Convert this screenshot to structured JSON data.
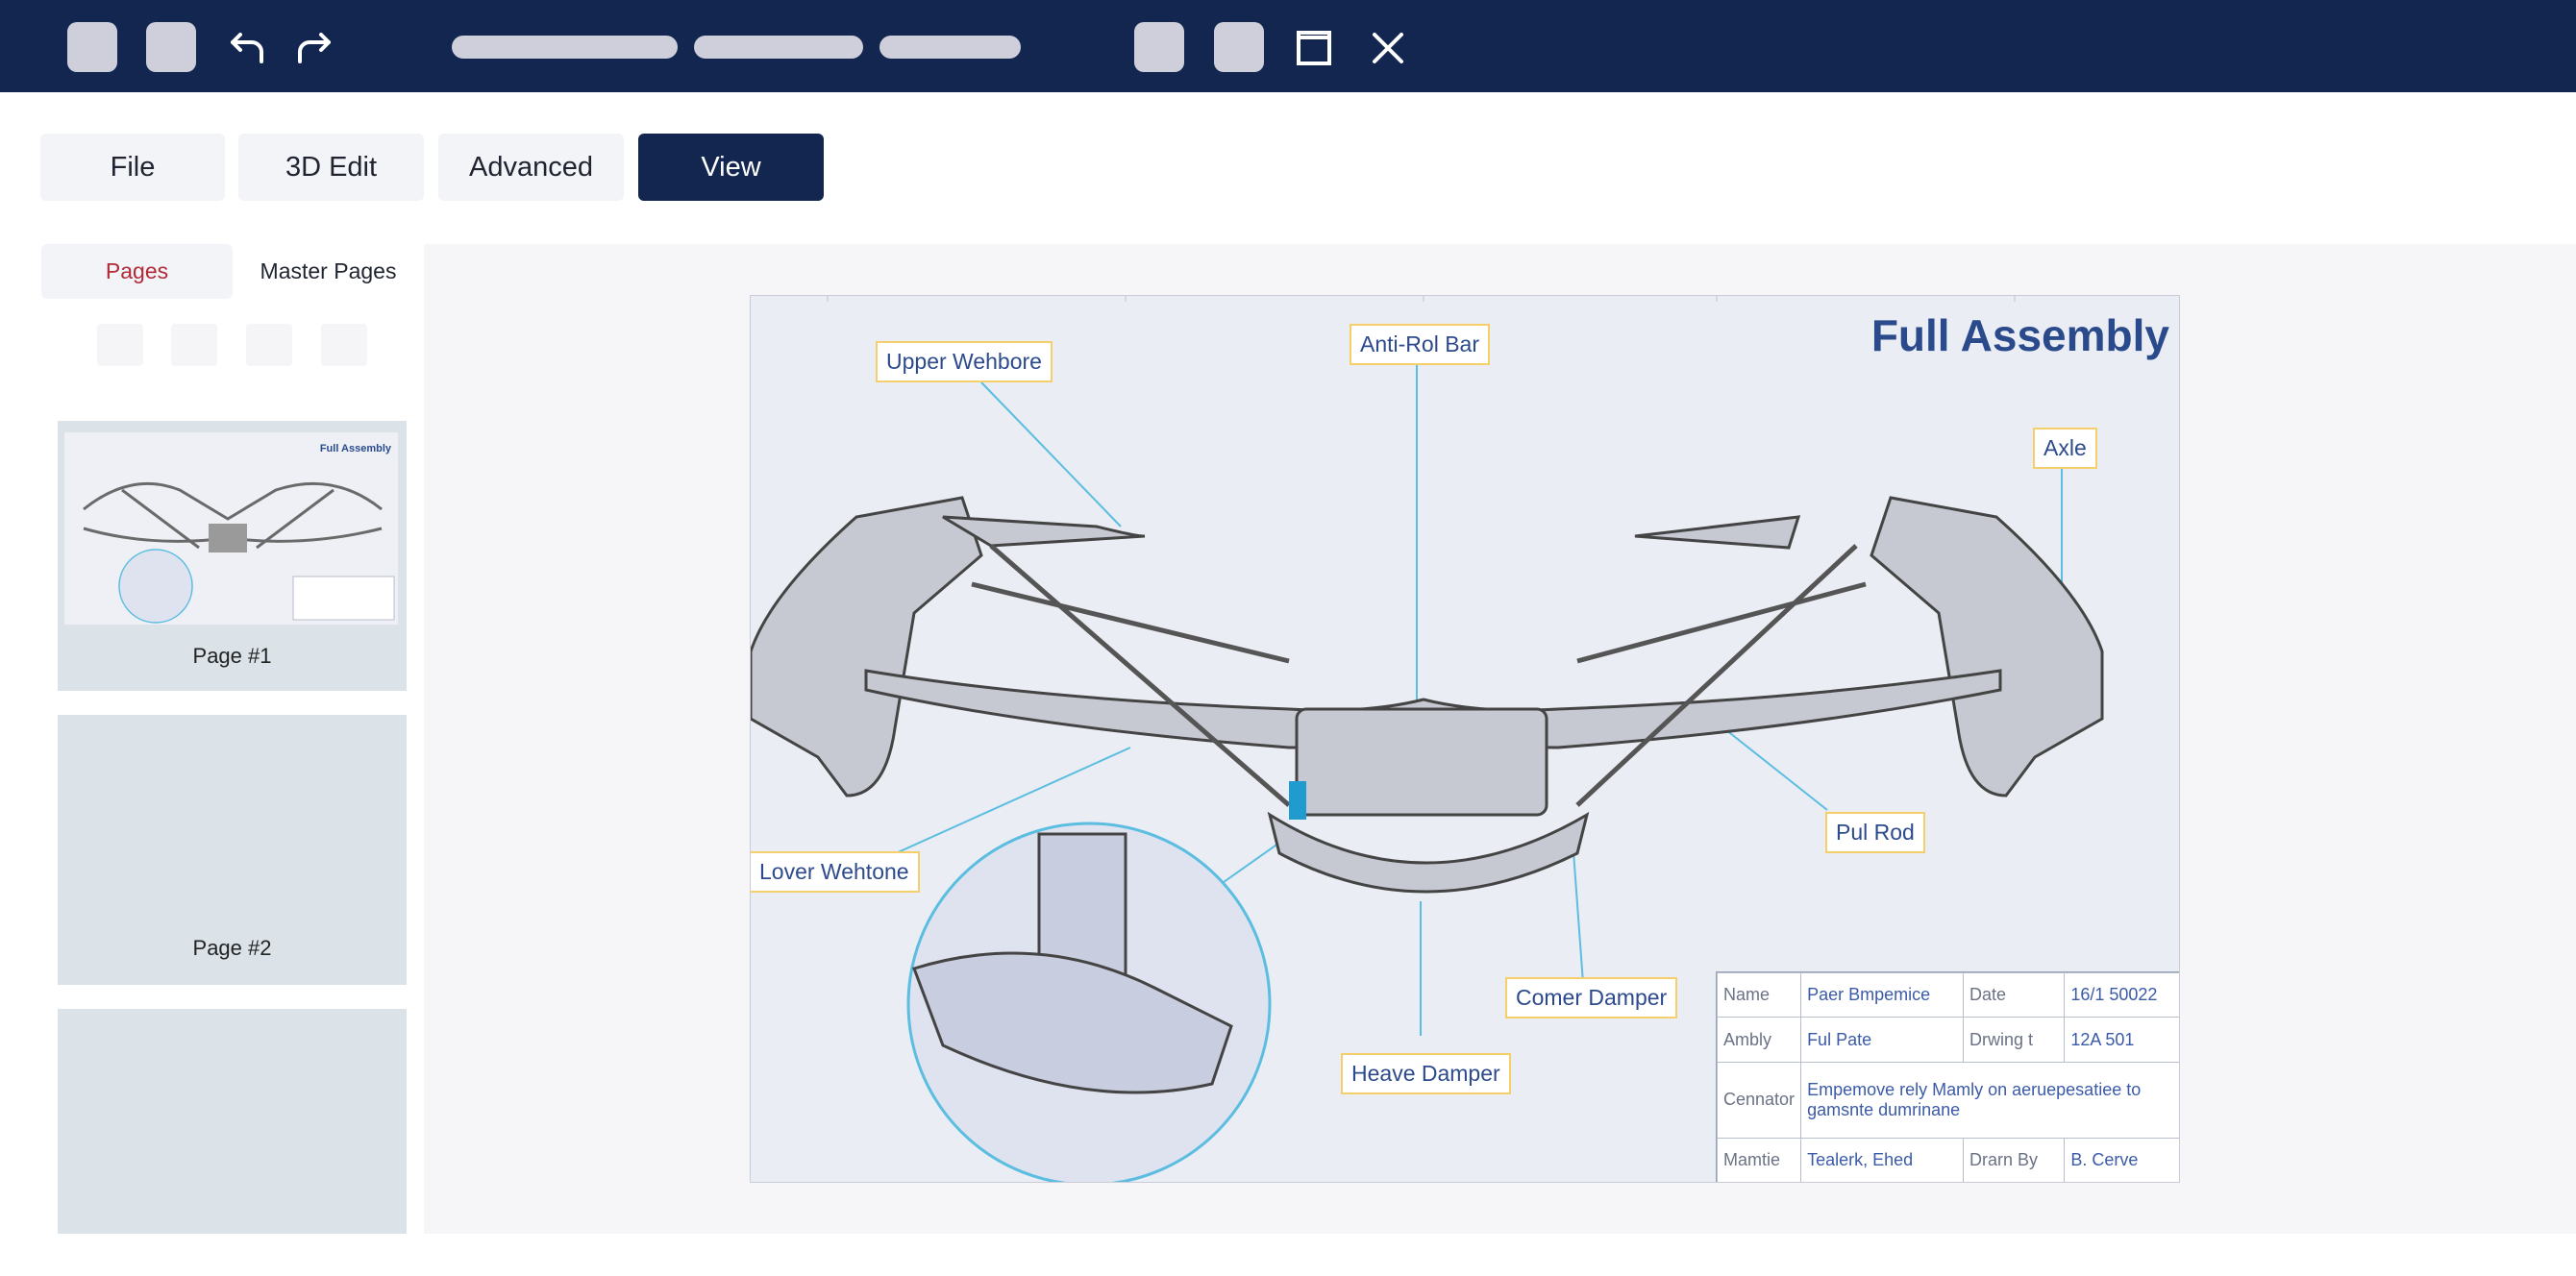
{
  "toolbar": {
    "undo_icon": "undo-arrow-icon",
    "redo_icon": "redo-arrow-icon",
    "maximize_icon": "maximize-square-icon",
    "close_icon": "close-x-icon"
  },
  "menu": {
    "file": "File",
    "edit3d": "3D Edit",
    "advanced": "Advanced",
    "view": "View"
  },
  "sidebar": {
    "tab_pages": "Pages",
    "tab_master": "Master Pages",
    "pages": [
      {
        "label": "Page #1"
      },
      {
        "label": "Page #2"
      },
      {
        "label": ""
      }
    ]
  },
  "drawing": {
    "title": "Full Assembly",
    "callouts": {
      "upper_wishbone": "Upper Wehbore",
      "anti_roll_bar": "Anti-Rol Bar",
      "axle": "Axle",
      "lower_wishbone": "Lover Wehtone",
      "pull_rod": "Pul Rod",
      "corner_damper": "Comer Damper",
      "heave_damper": "Heave Damper"
    },
    "title_block": {
      "name_k": "Name",
      "name_v": "Paer Bmpemice",
      "date_k": "Date",
      "date_v": "16/1 50022",
      "assembly_k": "Ambly",
      "assembly_v": "Ful Pate",
      "drawing_k": "Drwing t",
      "drawing_v": "12A 501",
      "comments_k": "Cennator",
      "comments_v": "Empemove rely Mamly on aeruepesatiee to gamsnte dumrinane",
      "material_k": "Mamtie",
      "material_v": "Tealerk, Ehed",
      "drawn_k": "Drarn By",
      "drawn_v": "B. Cerve"
    }
  },
  "colors": {
    "titlebar": "#12264f",
    "accent": "#12264f",
    "pages_tab_text": "#b02a37",
    "callout_border": "#f4cf6a",
    "leader_line": "#5bbde0"
  }
}
